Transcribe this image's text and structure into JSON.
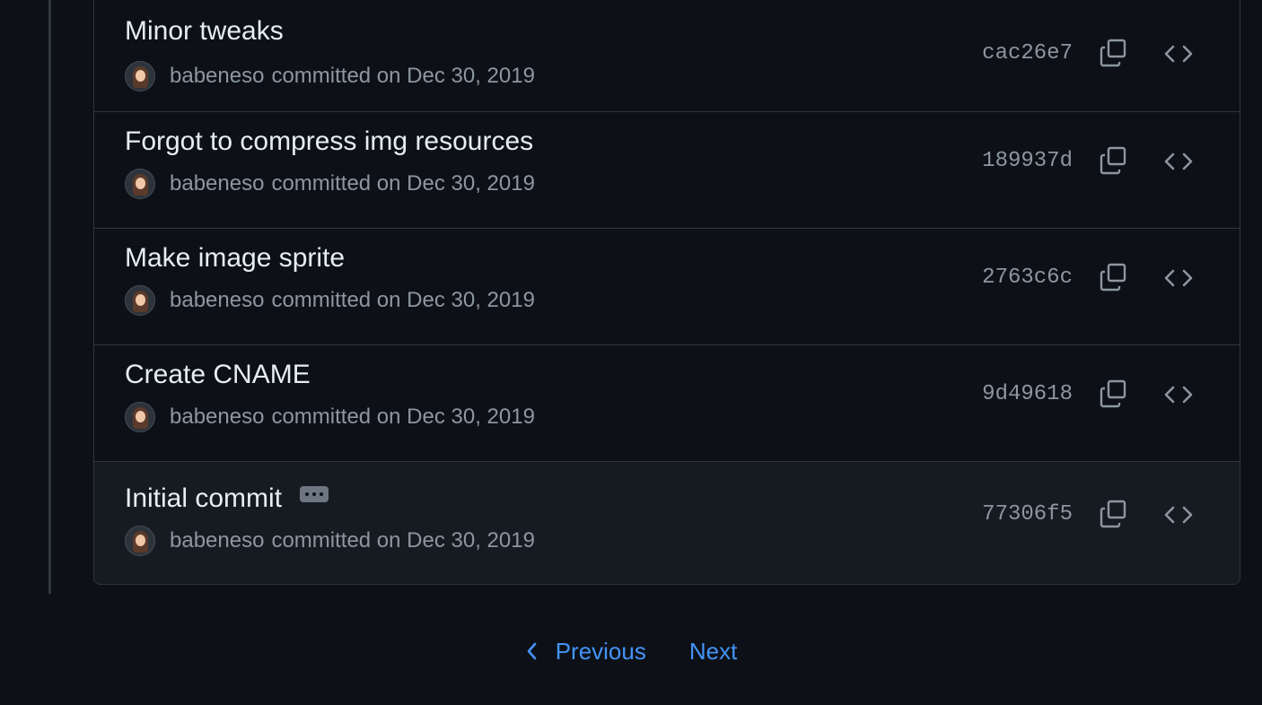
{
  "commits": [
    {
      "title": "Minor tweaks",
      "author": "babeneso",
      "date_text": "committed on Dec 30, 2019",
      "sha": "cac26e7"
    },
    {
      "title": "Forgot to compress img resources",
      "author": "babeneso",
      "date_text": "committed on Dec 30, 2019",
      "sha": "189937d"
    },
    {
      "title": "Make image sprite",
      "author": "babeneso",
      "date_text": "committed on Dec 30, 2019",
      "sha": "2763c6c"
    },
    {
      "title": "Create CNAME",
      "author": "babeneso",
      "date_text": "committed on Dec 30, 2019",
      "sha": "9d49618"
    },
    {
      "title": "Initial commit",
      "author": "babeneso",
      "date_text": "committed on Dec 30, 2019",
      "sha": "77306f5"
    }
  ],
  "pagination": {
    "previous_label": "Previous",
    "next_label": "Next"
  },
  "icons": {
    "copy": "copy-icon",
    "browse": "code-icon",
    "chevron": "chevron-left-icon",
    "ellipsis": "kebab-horizontal-icon"
  },
  "colors": {
    "background": "#0d1117",
    "border": "#30363d",
    "link": "#4493f8",
    "muted": "#8d96a0"
  }
}
